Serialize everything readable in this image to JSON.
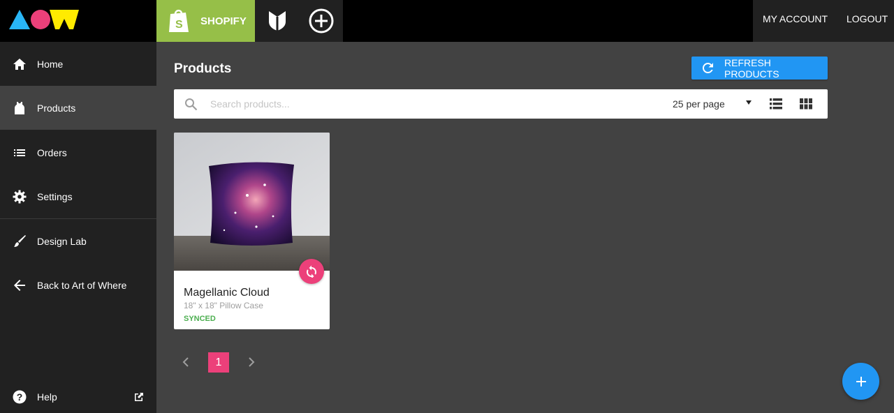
{
  "topbar": {
    "store_label": "SHOPIFY",
    "my_account": "MY ACCOUNT",
    "logout": "LOGOUT"
  },
  "sidebar": {
    "items": [
      {
        "label": "Home",
        "icon": "home-icon"
      },
      {
        "label": "Products",
        "icon": "tank-top-icon"
      },
      {
        "label": "Orders",
        "icon": "list-icon"
      },
      {
        "label": "Settings",
        "icon": "gear-icon"
      },
      {
        "label": "Design Lab",
        "icon": "brush-icon"
      },
      {
        "label": "Back to Art of Where",
        "icon": "arrow-left-icon"
      }
    ],
    "help": {
      "label": "Help",
      "icon": "help-icon"
    }
  },
  "main": {
    "title": "Products",
    "refresh_label": "REFRESH PRODUCTS",
    "search_placeholder": "Search products...",
    "per_page": "25 per page"
  },
  "products": [
    {
      "name": "Magellanic Cloud",
      "subtitle": "18\" x 18\" Pillow Case",
      "status": "SYNCED"
    }
  ],
  "pagination": {
    "current": "1"
  },
  "colors": {
    "shopify_green": "#96bf48",
    "accent_blue": "#2196f3",
    "accent_pink": "#ec407a",
    "synced_green": "#4caf50",
    "sidebar_bg": "#212121",
    "main_bg": "#424242"
  }
}
